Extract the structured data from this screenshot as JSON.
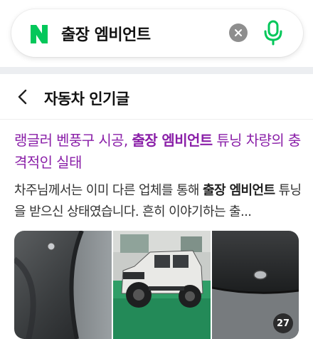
{
  "search": {
    "query": "출장 엠비언트",
    "brand_color": "#03c75a"
  },
  "section": {
    "title": "자동차 인기글"
  },
  "article": {
    "title_part1": "랭글러 벤풍구 시공, ",
    "title_keyword": "출장 엠비언트",
    "title_part2": " 튜닝 차량의 충격적인 실태",
    "title_color": "#8a1fa8",
    "snippet_part1": "차주님께서는 이미 다른 업체를 통해 ",
    "snippet_keyword": "출장 엠비언트",
    "snippet_part2": " 튜닝을 받으신 상태였습니다. 흔히 이야기하는 출...",
    "image_count": "27"
  },
  "icons": {
    "logo": "naver-n-logo",
    "clear": "clear-icon",
    "mic": "microphone-icon",
    "back": "back-chevron-icon"
  }
}
